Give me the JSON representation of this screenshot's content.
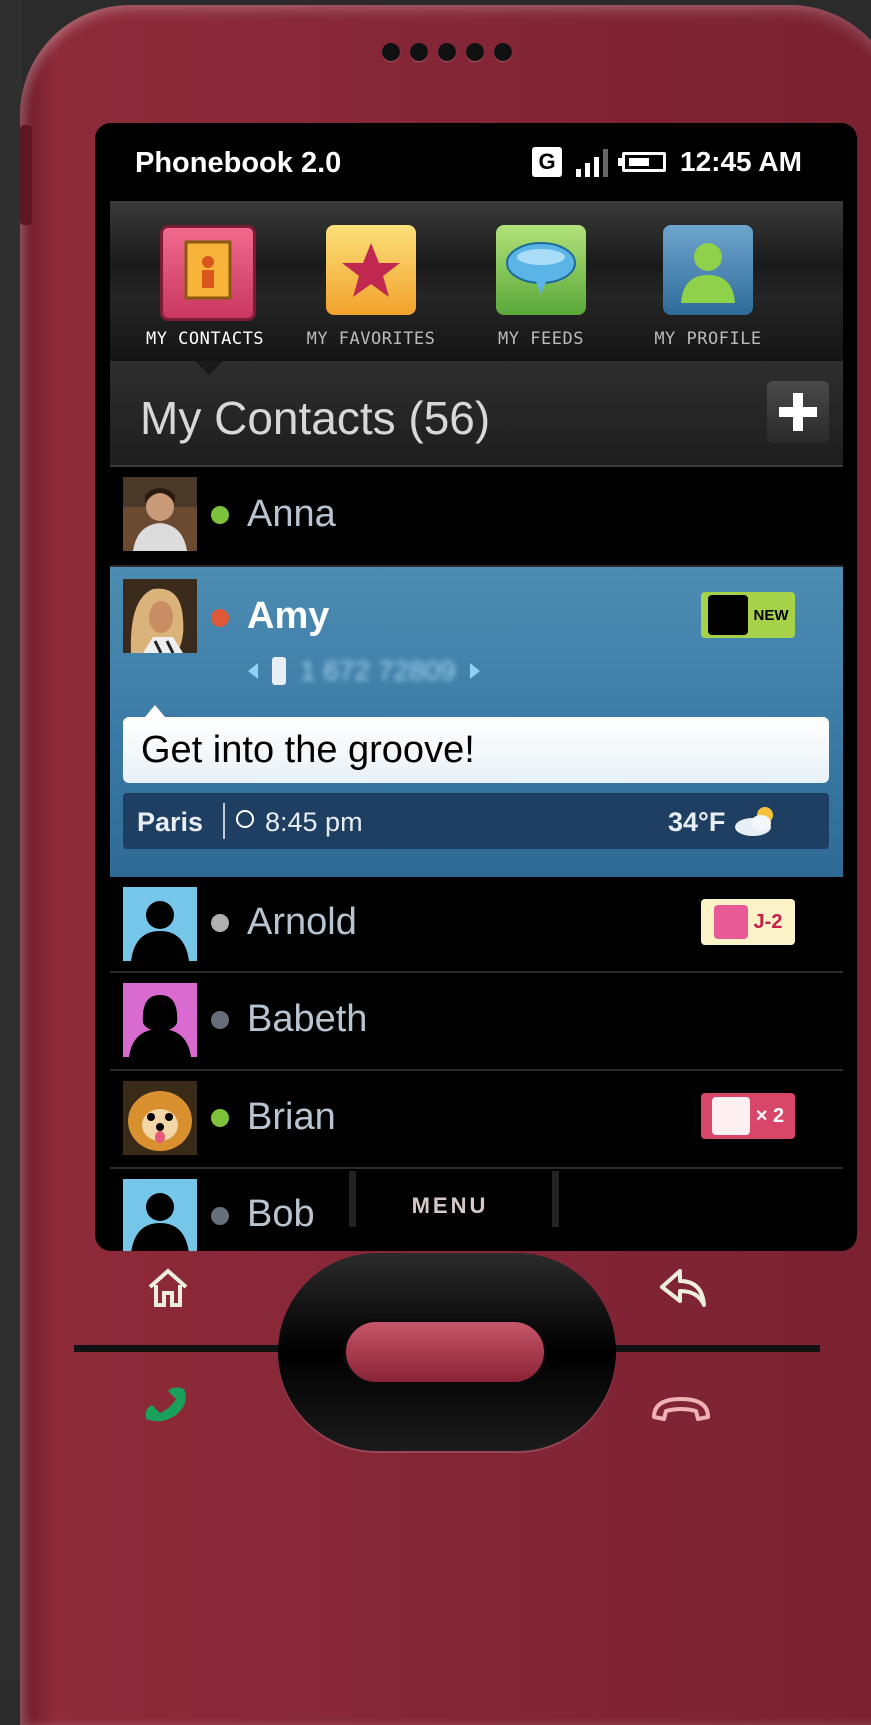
{
  "app": {
    "title": "Phonebook 2.0"
  },
  "status_bar": {
    "network": "G",
    "time": "12:45 AM"
  },
  "tabs": [
    {
      "label": "MY CONTACTS",
      "icon": "address-book-icon",
      "active": true
    },
    {
      "label": "MY FAVORITES",
      "icon": "star-icon",
      "active": false
    },
    {
      "label": "MY FEEDS",
      "icon": "speech-bubble-icon",
      "active": false
    },
    {
      "label": "MY PROFILE",
      "icon": "person-icon",
      "active": false
    }
  ],
  "list": {
    "title": "My Contacts (56)",
    "add_icon": "plus-icon"
  },
  "contacts": [
    {
      "name": "Anna",
      "status": "online"
    },
    {
      "name": "Amy",
      "status": "busy",
      "expanded": true,
      "phone": "1 672 72809",
      "message": "Get into the groove!",
      "city": "Paris",
      "local_time": "8:45 pm",
      "temperature": "34°F",
      "weather_icon": "partly-cloudy-icon",
      "badge": {
        "text": "NEW",
        "icon": "speech-bubble-icon"
      }
    },
    {
      "name": "Arnold",
      "status": "away",
      "badge": {
        "text": "J-2",
        "icon": "birthday-cake-icon"
      }
    },
    {
      "name": "Babeth",
      "status": "offline"
    },
    {
      "name": "Brian",
      "status": "online",
      "badge": {
        "text": "× 2",
        "icon": "missed-call-icon"
      }
    },
    {
      "name": "Bob",
      "status": "offline"
    }
  ],
  "hardware": {
    "menu_label": "MENU"
  },
  "colors": {
    "phone_body": "#842637",
    "highlight": "#3a7aa5",
    "online": "#7ec23b",
    "busy": "#e05a3a"
  }
}
